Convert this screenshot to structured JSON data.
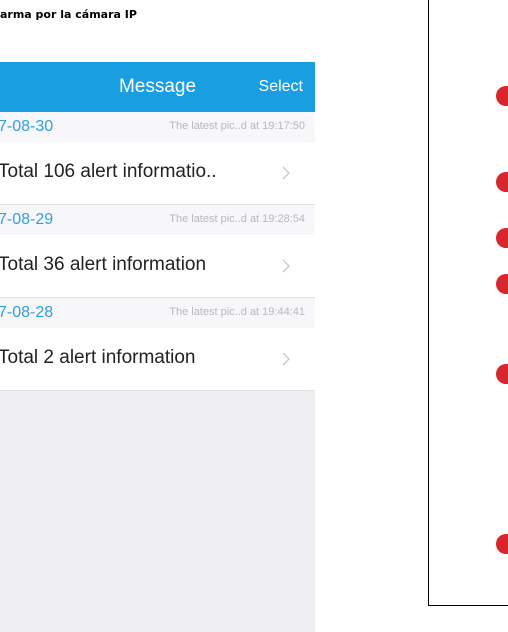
{
  "document": {
    "title": "arma por la cámara IP"
  },
  "app": {
    "nav": {
      "title": "Message",
      "select_label": "Select"
    },
    "groups": [
      {
        "date": "7-08-30",
        "latest": "The latest pic..d at 19:17:50",
        "item": "Total 106 alert informatio.."
      },
      {
        "date": "7-08-29",
        "latest": "The latest pic..d at 19:28:54",
        "item": "Total 36 alert information"
      },
      {
        "date": "7-08-28",
        "latest": "The latest pic..d at 19:44:41",
        "item": "Total 2 alert information"
      }
    ]
  },
  "colors": {
    "nav_background": "#1a9ee2",
    "date_text": "#2f9fdd",
    "marker": "#d7262c"
  }
}
